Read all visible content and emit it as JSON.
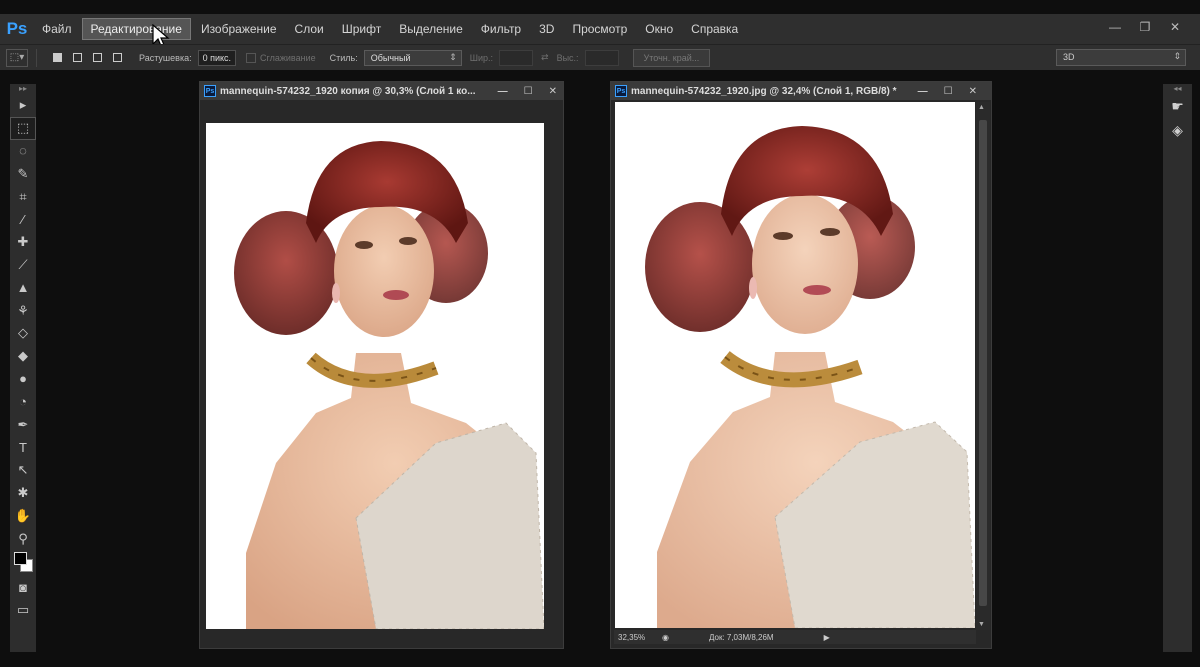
{
  "app": {
    "logo": "Ps",
    "menu": [
      "Файл",
      "Редактирование",
      "Изображение",
      "Слои",
      "Шрифт",
      "Выделение",
      "Фильтр",
      "3D",
      "Просмотр",
      "Окно",
      "Справка"
    ],
    "active_menu_index": 1,
    "window_controls": [
      "—",
      "❐",
      "✕"
    ]
  },
  "options": {
    "feather_label": "Растушевка:",
    "feather_value": "0 пикс.",
    "antialias_label": "Сглаживание",
    "style_label": "Стиль:",
    "style_value": "Обычный",
    "width_label": "Шир.:",
    "height_label": "Выс.:",
    "refine_label": "Уточн. край...",
    "workspace": "3D"
  },
  "tools": [
    {
      "icon": "move-icon",
      "glyph": "▸"
    },
    {
      "icon": "marquee-icon",
      "glyph": "⬚",
      "selected": true
    },
    {
      "icon": "lasso-icon",
      "glyph": "◌"
    },
    {
      "icon": "quick-select-icon",
      "glyph": "✎"
    },
    {
      "icon": "crop-icon",
      "glyph": "⌗"
    },
    {
      "icon": "eyedropper-icon",
      "glyph": "⁄"
    },
    {
      "icon": "healing-icon",
      "glyph": "✚"
    },
    {
      "icon": "brush-icon",
      "glyph": "⟋"
    },
    {
      "icon": "stamp-icon",
      "glyph": "▲"
    },
    {
      "icon": "history-brush-icon",
      "glyph": "⚘"
    },
    {
      "icon": "eraser-icon",
      "glyph": "◇"
    },
    {
      "icon": "bucket-icon",
      "glyph": "◆"
    },
    {
      "icon": "blur-icon",
      "glyph": "●"
    },
    {
      "icon": "dodge-icon",
      "glyph": "◔"
    },
    {
      "icon": "pen-icon",
      "glyph": "✒"
    },
    {
      "icon": "type-icon",
      "glyph": "T"
    },
    {
      "icon": "path-select-icon",
      "glyph": "↖"
    },
    {
      "icon": "shape-icon",
      "glyph": "✱"
    },
    {
      "icon": "hand-icon",
      "glyph": "✋"
    },
    {
      "icon": "zoom-icon",
      "glyph": "⚲"
    }
  ],
  "right_panel": [
    {
      "icon": "history-panel-icon",
      "glyph": "☛"
    },
    {
      "icon": "layers-panel-icon",
      "glyph": "◈"
    }
  ],
  "documents": [
    {
      "title": "mannequin-574232_1920 копия @ 30,3% (Слой 1 ко...",
      "controls": [
        "—",
        "☐",
        "✕"
      ]
    },
    {
      "title": "mannequin-574232_1920.jpg @ 32,4% (Слой 1, RGB/8) *",
      "controls": [
        "—",
        "☐",
        "✕"
      ],
      "zoom": "32,35%",
      "doc_size": "Док: 7,03M/8,26M"
    }
  ]
}
